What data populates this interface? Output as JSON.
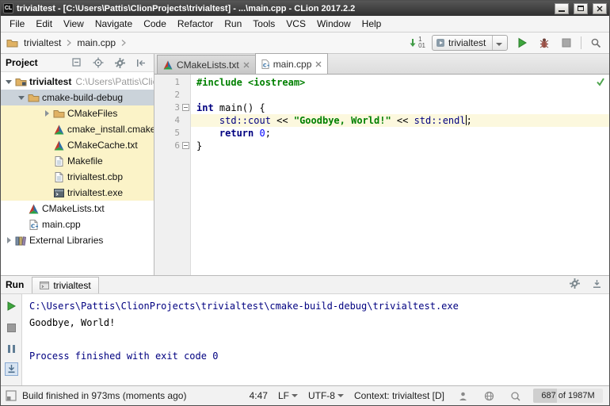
{
  "titlebar": {
    "logo": "CL",
    "title": "trivialtest - [C:\\Users\\Pattis\\ClionProjects\\trivialtest] - ...\\main.cpp - CLion 2017.2.2"
  },
  "menubar": {
    "items": [
      "File",
      "Edit",
      "View",
      "Navigate",
      "Code",
      "Refactor",
      "Run",
      "Tools",
      "VCS",
      "Window",
      "Help"
    ]
  },
  "navbar": {
    "crumb1": "trivialtest",
    "crumb2": "main.cpp",
    "badge_top": "1",
    "badge_bottom": "01",
    "run_config": "trivialtest"
  },
  "project": {
    "title": "Project",
    "root_label": "trivialtest",
    "root_path": "C:\\Users\\Pattis\\Clio",
    "items": {
      "build_dir": "cmake-build-debug",
      "cmakefiles": "CMakeFiles",
      "cmake_install": "cmake_install.cmake",
      "cmakecache": "CMakeCache.txt",
      "makefile": "Makefile",
      "cbp": "trivialtest.cbp",
      "exe": "trivialtest.exe",
      "cmakelists": "CMakeLists.txt",
      "maincpp": "main.cpp",
      "external": "External Libraries"
    }
  },
  "editor": {
    "tab1": "CMakeLists.txt",
    "tab2": "main.cpp",
    "gutter": [
      "1",
      "2",
      "3",
      "4",
      "5",
      "6"
    ],
    "code": {
      "l1_pp": "#include <iostream>",
      "l3_kw": "int",
      "l3_rest": " main() {",
      "l4_ind": "    ",
      "l4_ns1": "std::cout",
      "l4_op1": " << ",
      "l4_str": "\"Goodbye, World!\"",
      "l4_op2": " << ",
      "l4_ns2": "std::endl",
      "l4_semi": ";",
      "l5_ind": "    ",
      "l5_kw": "return",
      "l5_sp": " ",
      "l5_num": "0",
      "l5_semi": ";",
      "l6": "}"
    }
  },
  "run": {
    "title": "Run",
    "tab": "trivialtest",
    "console": {
      "line1": "C:\\Users\\Pattis\\ClionProjects\\trivialtest\\cmake-build-debug\\trivialtest.exe",
      "line2": "Goodbye, World!",
      "line3": "",
      "line4": "Process finished with exit code 0"
    }
  },
  "statusbar": {
    "message": "Build finished in 973ms (moments ago)",
    "position": "4:47",
    "line_sep": "LF",
    "encoding": "UTF-8",
    "context": "Context: trivialtest [D]",
    "memory": "687 of 1987M"
  },
  "colors": {
    "keyword": "#000080",
    "string": "#008000",
    "system_output": "#000080",
    "run_green": "#3ea63e",
    "caret_row": "#fcf8de",
    "excluded_bg": "#fbf3c8",
    "selection_bg": "#cbd3da"
  }
}
